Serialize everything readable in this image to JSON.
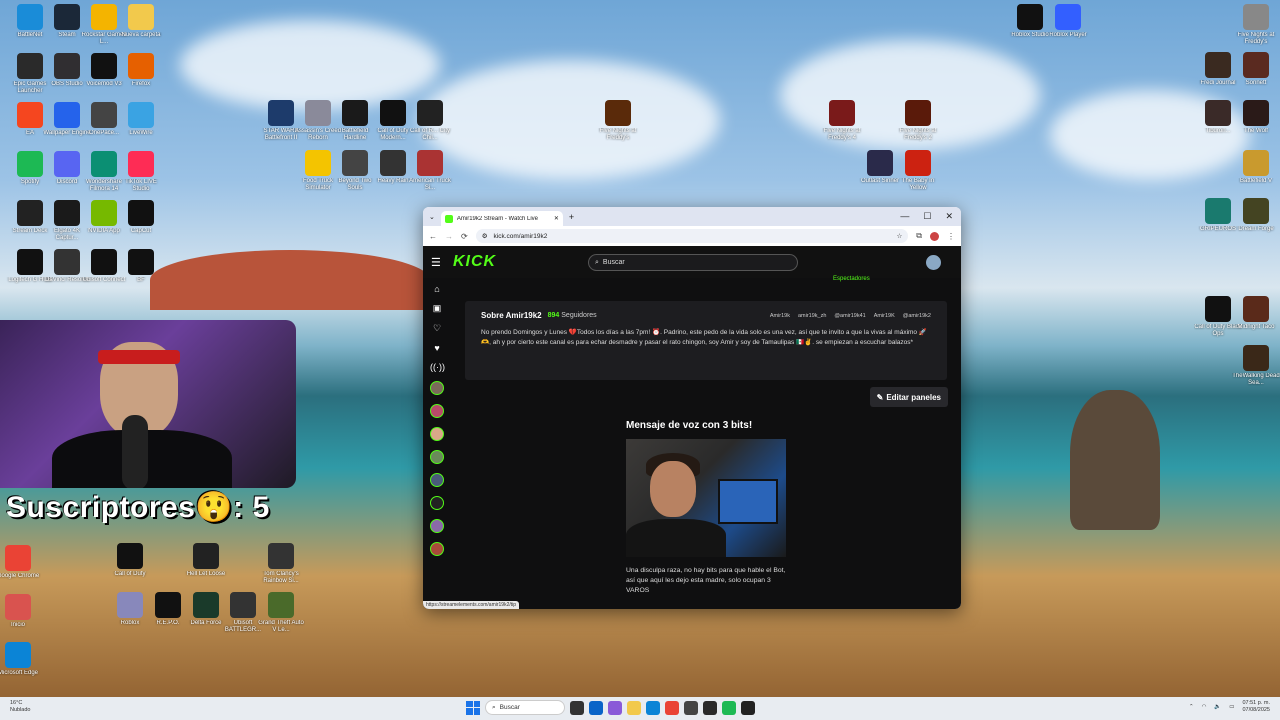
{
  "desktop": {
    "icons_left": [
      {
        "label": "BattleNet",
        "color": "#1a8cd8"
      },
      {
        "label": "Steam",
        "color": "#1b2838"
      },
      {
        "label": "Rockstar Games L...",
        "color": "#f4b400"
      },
      {
        "label": "Nueva carpeta",
        "color": "#f2c94c"
      },
      {
        "label": "Epic Games Launcher",
        "color": "#2a2a2a"
      },
      {
        "label": "OBS Studio",
        "color": "#302e31"
      },
      {
        "label": "Voicemod V3",
        "color": "#111"
      },
      {
        "label": "Firefox",
        "color": "#e66000"
      },
      {
        "label": "EA",
        "color": "#f5461f"
      },
      {
        "label": "Wallpaper Engine",
        "color": "#2563eb"
      },
      {
        "label": "OnePace...",
        "color": "#444"
      },
      {
        "label": "LiveWire",
        "color": "#3aa3e3"
      },
      {
        "label": "Spotify",
        "color": "#1db954"
      },
      {
        "label": "Discord",
        "color": "#5865f2"
      },
      {
        "label": "Wondershare Filmora 14",
        "color": "#0b8f73"
      },
      {
        "label": "TikTok LIVE Studio",
        "color": "#fe2c55"
      },
      {
        "label": "Stream Deck",
        "color": "#222"
      },
      {
        "label": "Elgato 4K Captur...",
        "color": "#1a1a1a"
      },
      {
        "label": "NVIDIA App",
        "color": "#76b900"
      },
      {
        "label": "CapCut",
        "color": "#111"
      },
      {
        "label": "Logitech G HUB",
        "color": "#111"
      },
      {
        "label": "DaVinci Resolve",
        "color": "#333"
      },
      {
        "label": "Ubisoft Connect",
        "color": "#111"
      },
      {
        "label": "BF",
        "color": "#111"
      }
    ],
    "icons_right": [
      {
        "label": "Roblox Studio",
        "color": "#111"
      },
      {
        "label": "Roblox Player",
        "color": "#335fff"
      },
      {
        "label": "Five Nights at Freddy's",
        "color": "#888"
      },
      {
        "label": "Fredi Journal",
        "color": "#3a2a20"
      },
      {
        "label": "Sonnett",
        "color": "#5a2a20"
      },
      {
        "label": "Tiburon...",
        "color": "#3a2a28"
      },
      {
        "label": "The Wolf",
        "color": "#2a1a18"
      },
      {
        "label": "Battlefield V",
        "color": "#c99a2e"
      },
      {
        "label": "GRIPEUROS",
        "color": "#1a7a6e"
      },
      {
        "label": "Dream Forge",
        "color": "#442"
      },
      {
        "label": "Call of Duty Black Ops",
        "color": "#111"
      },
      {
        "label": "Midnight Taco",
        "color": "#5a2a1a"
      },
      {
        "label": "TheWalking Dead Sea...",
        "color": "#3a2818"
      }
    ],
    "icons_top": [
      {
        "label": "STAR WARS Battlefront II",
        "color": "#1d3b6b"
      },
      {
        "label": "Assassin's Creed Reborn",
        "color": "#8a8a9a"
      },
      {
        "label": "Battlefield Hardline",
        "color": "#1a1a1a"
      },
      {
        "label": "Call of Duty Modern...",
        "color": "#111"
      },
      {
        "label": "Call of R... City Chil...",
        "color": "#222"
      },
      {
        "label": "Five Nights at Freddy's",
        "color": "#5a2a0a"
      },
      {
        "label": "Five Nights at Freddy's 4",
        "color": "#7a1a1a"
      },
      {
        "label": "Five Nights at Freddy's 2",
        "color": "#5a1a0a"
      },
      {
        "label": "Food Truck Simulator",
        "color": "#f4c400"
      },
      {
        "label": "Beyond Two Souls",
        "color": "#444"
      },
      {
        "label": "Heavy Rain",
        "color": "#333"
      },
      {
        "label": "American Truck Si...",
        "color": "#a33"
      },
      {
        "label": "Outlast Sinner",
        "color": "#2a2a4a"
      },
      {
        "label": "The Baby In Yellow",
        "color": "#c21"
      }
    ],
    "icons_bottom": [
      {
        "label": "Google Chrome",
        "color": "#ea4335"
      },
      {
        "label": "Call of Duty",
        "color": "#111"
      },
      {
        "label": "Hell Let Loose",
        "color": "#222"
      },
      {
        "label": "Tom Clancy's Rainbow Si...",
        "color": "#333"
      },
      {
        "label": "Inicio",
        "color": "#d9534f"
      },
      {
        "label": "Roblox",
        "color": "#88b"
      },
      {
        "label": "R.E.P.O.",
        "color": "#111"
      },
      {
        "label": "Delta Force",
        "color": "#1a3a2a"
      },
      {
        "label": "Ubisoft BATTLEGR...",
        "color": "#333"
      },
      {
        "label": "Grand Theft Auto V Le...",
        "color": "#4a6a2a"
      },
      {
        "label": "Microsoft Edge",
        "color": "#0b84d6"
      }
    ]
  },
  "overlay": {
    "subs_text": "Suscriptores",
    "subs_emoji": "😲",
    "subs_count": ": 5"
  },
  "browser": {
    "tab_title": "Amir19k2 Stream - Watch Live",
    "new_tab": "+",
    "url": "kick.com/amir19k2",
    "status_url": "https://streamelements.com/amir19k2/tip",
    "win_min": "—",
    "win_max": "☐",
    "win_close": "✕",
    "nav_back": "←",
    "nav_fwd": "→",
    "nav_reload": "⟳"
  },
  "kick": {
    "logo": "KICK",
    "search_placeholder": "Buscar",
    "top_viewers": "Espectadores",
    "about_name": "Sobre Amir19k2",
    "followers_count": "894",
    "followers_label": "Seguidores",
    "socials": [
      "Amir19k",
      "amir19k_zh",
      "@amir19k41",
      "Amir19K",
      "@amir19k2"
    ],
    "description": "No prendo Domingos y Lunes 💔Todos los días a las 7pm! ⏰. Padrino, este pedo de la vida solo es una vez, así que te invito a que la vivas al máximo 🚀🫶, ah y por cierto este canal es para echar desmadre y pasar el rato chingon, soy Amir y soy de Tamaulipas 🇲🇽✌️. se empiezan a escuchar balazos*",
    "edit_panels": "Editar paneles",
    "panel_title": "Mensaje de voz con 3 bits!",
    "panel_text": "Una disculpa raza, no hay bits para que hable el Bot, así que aquí les dejo esta madre, solo ocupan 3 VAROS",
    "accent": "#53fc18"
  },
  "taskbar": {
    "weather_temp": "16°C",
    "weather_desc": "Nublado",
    "search_placeholder": "Buscar",
    "time": "07:51 p. m.",
    "date": "07/08/2025"
  }
}
